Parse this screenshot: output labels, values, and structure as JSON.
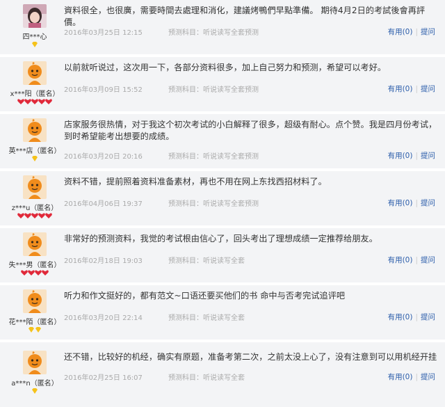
{
  "reviews": [
    {
      "username": "四***心",
      "avatar": "photo-avatar",
      "badge_count": 1,
      "badge_type": "diamond-yellow",
      "content": "資料很全，也很廣，需要時間去處理和消化，建議烤鴨們早點準備。 期待4月2日的考試後會再評價。",
      "date": "2016年03月25日 12:15",
      "product_label": "预测科目：听说读写全套预测",
      "useful_label": "有用",
      "useful_count": "(0)",
      "ask_label": "提问"
    },
    {
      "username": "x***阳（匿名）",
      "avatar": "default-avatar",
      "badge_count": 5,
      "badge_type": "heart-red",
      "content": "以前就听说过，这次用一下，各部分资料很多，加上自己努力和预测，希望可以考好。",
      "date": "2016年03月09日 15:52",
      "product_label": "预测科目：听说读写全套预测",
      "useful_label": "有用",
      "useful_count": "(0)",
      "ask_label": "提问"
    },
    {
      "username": "英***店（匿名）",
      "avatar": "default-avatar",
      "badge_count": 1,
      "badge_type": "diamond-yellow",
      "content": "店家服务很热情，对于我这个初次考试的小白解释了很多，超级有耐心。点个赞。我是四月份考试，到时希望能考出想要的成绩。",
      "date": "2016年03月20日 20:16",
      "product_label": "预测科目：听说读写全套预测",
      "useful_label": "有用",
      "useful_count": "(0)",
      "ask_label": "提问"
    },
    {
      "username": "z***u（匿名）",
      "avatar": "default-avatar",
      "badge_count": 5,
      "badge_type": "heart-red",
      "content": "资料不错，提前照着资料准备素材，再也不用在网上东找西招材料了。",
      "date": "2016年04月06日 19:37",
      "product_label": "预测科目：听说读写全套预测",
      "useful_label": "有用",
      "useful_count": "(0)",
      "ask_label": "提问"
    },
    {
      "username": "失***男（匿名）",
      "avatar": "default-avatar",
      "badge_count": 4,
      "badge_type": "heart-red",
      "content": "非常好的预测资料，我觉的考试根由信心了，回头考出了理想成绩一定推荐给朋友。",
      "date": "2016年02月18日 19:03",
      "product_label": "预测科目：听说读写全套",
      "useful_label": "有用",
      "useful_count": "(0)",
      "ask_label": "提问"
    },
    {
      "username": "花***陌（匿名）",
      "avatar": "default-avatar",
      "badge_count": 2,
      "badge_type": "diamond-yellow",
      "content": "听力和作文挺好的，都有范文~口语还要买他们的书 命中与否考完试追评吧",
      "date": "2016年03月20日 22:14",
      "product_label": "预测科目：听说读写全套",
      "useful_label": "有用",
      "useful_count": "(0)",
      "ask_label": "提问"
    },
    {
      "username": "a***n（匿名）",
      "avatar": "default-avatar",
      "badge_count": 1,
      "badge_type": "diamond-yellow",
      "content": "还不错，比较好的机经，确实有原题，准备考第二次，之前太没上心了，没有注意到可以用机经开挂",
      "date": "2016年02月25日 16:07",
      "product_label": "预测科目：听说读写全套",
      "useful_label": "有用",
      "useful_count": "(0)",
      "ask_label": "提问"
    }
  ],
  "colors": {
    "row_bg": "#f3f4f6",
    "link": "#2a5caa",
    "meta": "#aaaaaa",
    "avatar_orange": "#f08c1c",
    "heart_red": "#e0293a",
    "diamond_yellow": "#f5c21b"
  }
}
